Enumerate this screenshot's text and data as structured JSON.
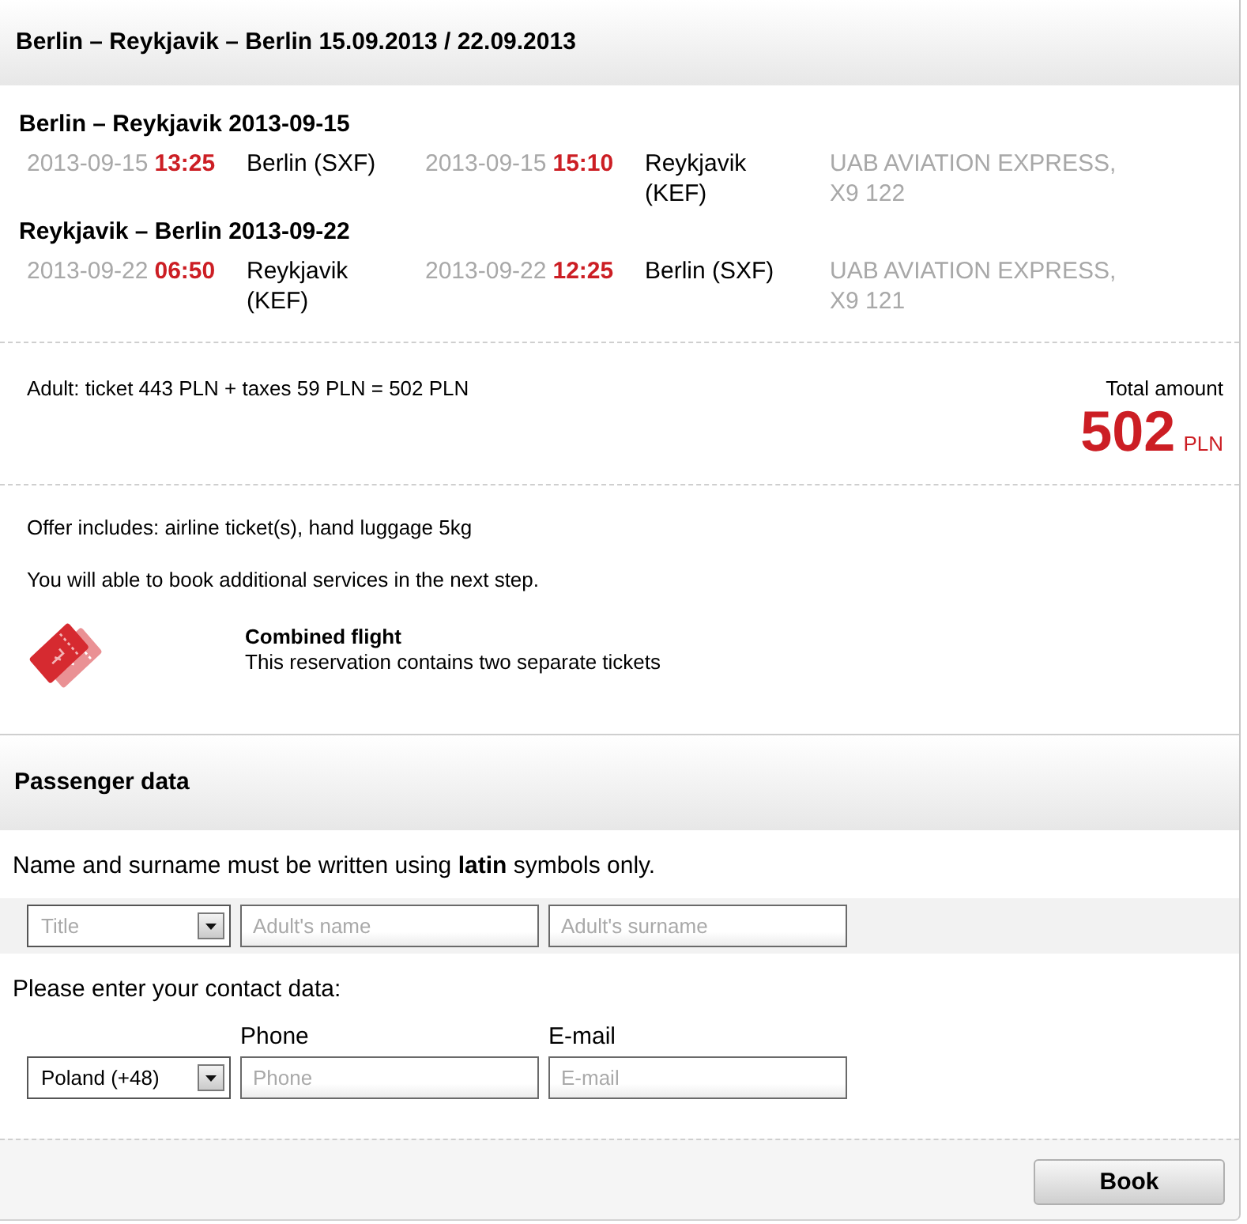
{
  "header": {
    "title": "Berlin – Reykjavik – Berlin 15.09.2013 / 22.09.2013"
  },
  "flights": [
    {
      "title": "Berlin – Reykjavik 2013-09-15",
      "departure": {
        "date": "2013-09-15",
        "time": "13:25",
        "airport": "Berlin (SXF)"
      },
      "arrival": {
        "date": "2013-09-15",
        "time": "15:10",
        "airport": "Reykjavik (KEF)"
      },
      "carrier": "UAB AVIATION EXPRESS, X9 122"
    },
    {
      "title": "Reykjavik – Berlin 2013-09-22",
      "departure": {
        "date": "2013-09-22",
        "time": "06:50",
        "airport": "Reykjavik (KEF)"
      },
      "arrival": {
        "date": "2013-09-22",
        "time": "12:25",
        "airport": "Berlin (SXF)"
      },
      "carrier": "UAB AVIATION EXPRESS, X9 121"
    }
  ],
  "price": {
    "breakdown": "Adult: ticket 443 PLN + taxes 59 PLN = 502 PLN",
    "total_label": "Total amount",
    "total": "502",
    "currency": "PLN"
  },
  "offer": {
    "notes": [
      "Offer includes: airline ticket(s), hand luggage 5kg",
      "You will able to book additional services in the next step."
    ],
    "combined": {
      "title": "Combined flight",
      "text": "This reservation contains two separate tickets"
    }
  },
  "passenger": {
    "title": "Passenger data",
    "name_note": "Name and surname must be written using **latin** symbols only.",
    "name_fields": [
      {
        "kind": "select",
        "placeholder": "Title"
      },
      {
        "kind": "input",
        "placeholder": "Adult's name"
      },
      {
        "kind": "input",
        "placeholder": "Adult's surname"
      }
    ],
    "contact_note": "Please enter your contact data:",
    "contact_fields": [
      {
        "kind": "select",
        "value": "Poland (+48)"
      },
      {
        "kind": "input",
        "label": "Phone",
        "placeholder": "Phone"
      },
      {
        "kind": "input",
        "label": "E-mail",
        "placeholder": "E-mail"
      }
    ]
  },
  "actions": {
    "book": "Book"
  }
}
